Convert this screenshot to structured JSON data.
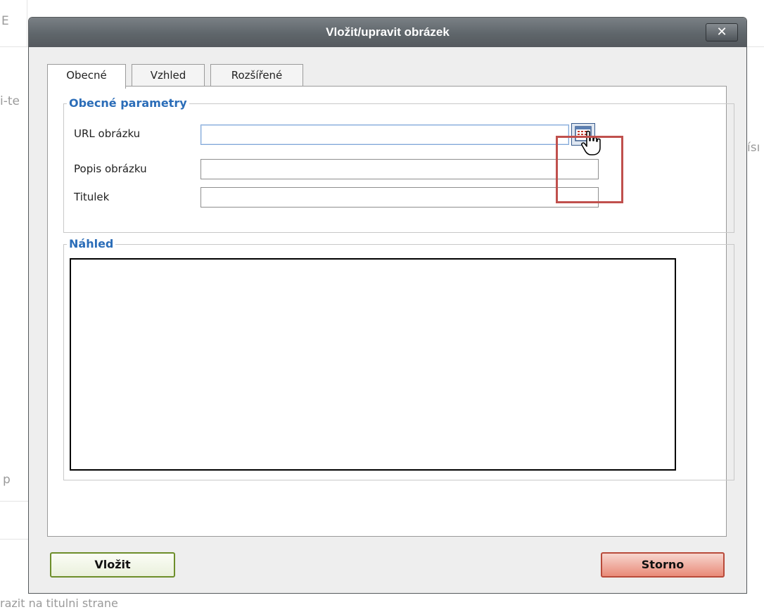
{
  "background": {
    "top_tab_fragment": "E",
    "left_fragment": "i-te",
    "right_fragment": "ísı",
    "side_fragment": "p",
    "bottom_text": "razit na titulni strane"
  },
  "dialog": {
    "title": "Vložit/upravit obrázek",
    "close_label": "✕",
    "tabs": [
      {
        "label": "Obecné",
        "active": true
      },
      {
        "label": "Vzhled",
        "active": false
      },
      {
        "label": "Rozšířené",
        "active": false
      }
    ],
    "general_section": {
      "legend": "Obecné parametry",
      "fields": [
        {
          "label": "URL obrázku",
          "value": ""
        },
        {
          "label": "Popis obrázku",
          "value": ""
        },
        {
          "label": "Titulek",
          "value": ""
        }
      ],
      "browse_icon": "browse-files-icon"
    },
    "preview_section": {
      "legend": "Náhled"
    },
    "buttons": {
      "insert": "Vložit",
      "cancel": "Storno"
    }
  },
  "colors": {
    "titlebar": "#5f666b",
    "legend": "#2b6db8",
    "highlight": "#c0504d",
    "insert_border": "#6d8e2a",
    "cancel_fill": "#e98a78"
  }
}
